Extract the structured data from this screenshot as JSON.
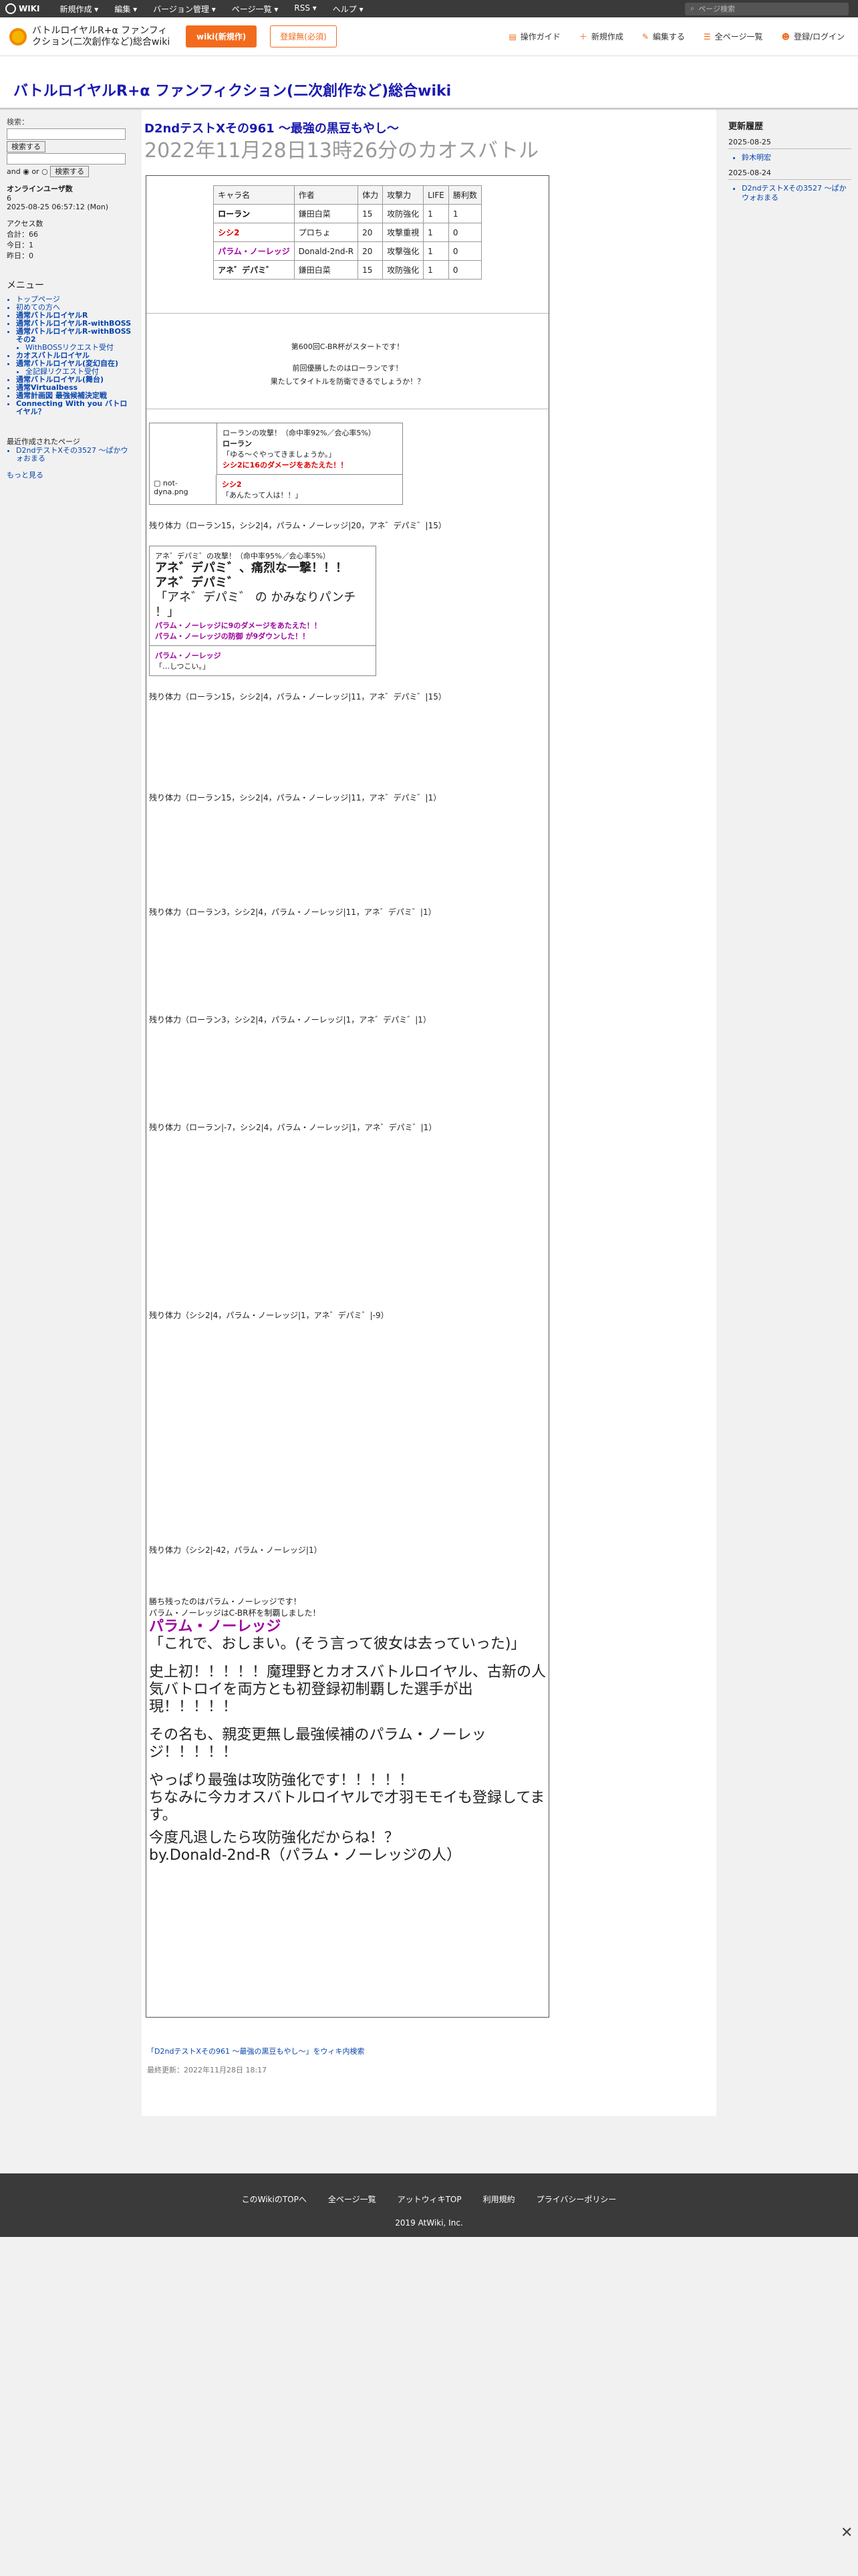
{
  "topbar": {
    "logo": "WIKI",
    "menu": [
      "新規作成 ▾",
      "編集 ▾",
      "バージョン管理 ▾",
      "ページ一覧 ▾",
      "RSS ▾",
      "ヘルプ ▾"
    ],
    "search_placeholder": "ページ検索"
  },
  "header": {
    "wiki_name": "バトルロイヤルR+α ファンフィクション(二次創作など)総合wiki",
    "btn_new": "wiki(新規作)",
    "btn_register": "登録無(必須)",
    "nav": [
      "操作ガイド",
      "新規作成",
      "編集する",
      "全ページ一覧",
      "登録/ログイン"
    ]
  },
  "page_title": "バトルロイヤルR+α ファンフィクション(二次創作など)総合wiki",
  "left": {
    "search_label": "検索：",
    "search_btn": "検索する",
    "and_label": "and",
    "or_label": "or",
    "online_label": "オンラインユーザ数",
    "online_count": "6",
    "datetime": "2025-08-25 06:57:12 (Mon)",
    "access": "アクセス数",
    "total": "合計：66",
    "today": "今日：1",
    "yesterday": "昨日：0",
    "menu_title": "メニュー",
    "menu_items": [
      "トップページ",
      "初めての方へ",
      "通常バトルロイヤルR",
      "通常バトルロイヤルR-withBOSS",
      "通常バトルロイヤルR-withBOSSその2",
      "WithBOSSリクエスト受付",
      "カオスバトルロイヤル",
      "通常バトルロイヤル(変幻自在)",
      "全記録リクエスト受付",
      "通常バトルロイヤル(舞台)",
      "通常Virtualbess",
      "通常計画図 最強候補決定戦",
      "Connecting With you バトロイヤル？"
    ],
    "more_link": "もっと見る",
    "recent_title": "最近作成されたページ",
    "recent_items": [
      "D2ndテストXその3527 ～ぱかウォおまる"
    ]
  },
  "article": {
    "title1": "D2ndテストXその961 ～最強の黒豆もやし～",
    "title2": "2022年11月28日13時26分のカオスバトル",
    "roster_head": [
      "キャラ名",
      "作者",
      "体力",
      "攻撃力",
      "LIFE",
      "勝利数"
    ],
    "roster_rows": [
      [
        "ローラン",
        "鎌田白菜",
        "15",
        "攻防強化",
        "1",
        "1"
      ],
      [
        "シシ2",
        "プロちょ",
        "20",
        "攻撃重視",
        "1",
        "0"
      ],
      [
        "パラム・ノーレッジ",
        "Donald-2nd-R",
        "20",
        "攻撃強化",
        "1",
        "0"
      ],
      [
        "アネ゛デパミ゛",
        "鎌田白菜",
        "15",
        "攻防強化",
        "1",
        "0"
      ]
    ],
    "intro1": "第600回C-BR杯がスタートです！",
    "intro2": "前回優勝したのはローランです！",
    "intro3": "果たしてタイトルを防衛できるでしょうか！？",
    "status_lines": [
      "残り体力（ローラン15，シシ2|4，パラム・ノーレッジ|20，アネ゛デパミ゛|15）",
      "残り体力（ローラン15，シシ2|4，パラム・ノーレッジ|11，アネ゛デパミ゛|15）",
      "残り体力（ローラン15，シシ2|4，パラム・ノーレッジ|11，アネ゛デパミ゛|1）",
      "残り体力（ローラン3，シシ2|4，パラム・ノーレッジ|11，アネ゛デパミ゛|1）",
      "残り体力（ローラン3，シシ2|4，パラム・ノーレッジ|1，アネ゛デパミ゛|1）",
      "残り体力（ローラン|-7，シシ2|4，パラム・ノーレッジ|1，アネ゛デパミ゛|1）",
      "残り体力（シシ2|4，パラム・ノーレッジ|1，アネ゛デパミ゛|-9）",
      "残り体力（シシ2|-42，パラム・ノーレッジ|1）"
    ],
    "b1_attack": "ローランの攻撃！（命中率92%／会心率5%）",
    "b1_name": "ローラン",
    "b1_quote": "「ゆる～ぐやってきましょうか。」",
    "b1_result": "シシ2に16のダメージをあたえた！！",
    "b1_name2": "シシ2",
    "b1_quote2": "「あんたって人は！！」",
    "b2_attack": "アネ゛デパミ゛の攻撃！（命中率95%／会心率5%）",
    "b2_line1": "アネ゛デパミ゛、痛烈な一撃！！！",
    "b2_name": "アネ゛デパミ゛",
    "b2_quote": "「アネ゛デパミ゛ の かみなりパンチ ！」",
    "b2_res1": "パラム・ノーレッジに9のダメージをあたえた！！",
    "b2_res2": "パラム・ノーレッジの防御 が9ダウンした！！",
    "b2_name2": "パラム・ノーレッジ",
    "b2_quote2": "「…しつこい。」",
    "final_lines": [
      "勝ち残ったのはパラム・ノーレッジです！",
      "パラム・ノーレッジはC-BR杯を制覇しました！",
      "パラム・ノーレッジ",
      "「これで、おしまい。(そう言って彼女は去っていった)」",
      "史上初！！！！！魔理野とカオスバトルロイヤル、古新の人気バトロイを両方とも初登録初制覇した選手が出現！！！！！",
      "その名も、親変更無し最強候補のパラム・ノーレッジ！！！！！",
      "やっぱり最強は攻防強化です！！！！！",
      "ちなみに今カオスバトルロイヤルで才羽モモイも登録してます。",
      "今度凡退したら攻防強化だからね！？",
      "by.Donald-2nd-R（パラム・ノーレッジの人）"
    ],
    "quote_link": "「D2ndテストXその961 ～最強の黒豆もやし～」をウィキ内検索",
    "last_updated": "最終更新：2022年11月28日 18:17"
  },
  "right": {
    "title": "更新履歴",
    "groups": [
      {
        "date": "2025-08-25",
        "items": [
          "鈴木明宏"
        ]
      },
      {
        "date": "2025-08-24",
        "items": [
          "D2ndテストXその3527 ～ぱかウォおまる"
        ]
      }
    ]
  },
  "footer": {
    "links": [
      "このWikiのTOPへ",
      "全ページ一覧",
      "アットウィキTOP",
      "利用規約",
      "プライバシーポリシー"
    ],
    "copyright": "2019 AtWiki, Inc."
  }
}
